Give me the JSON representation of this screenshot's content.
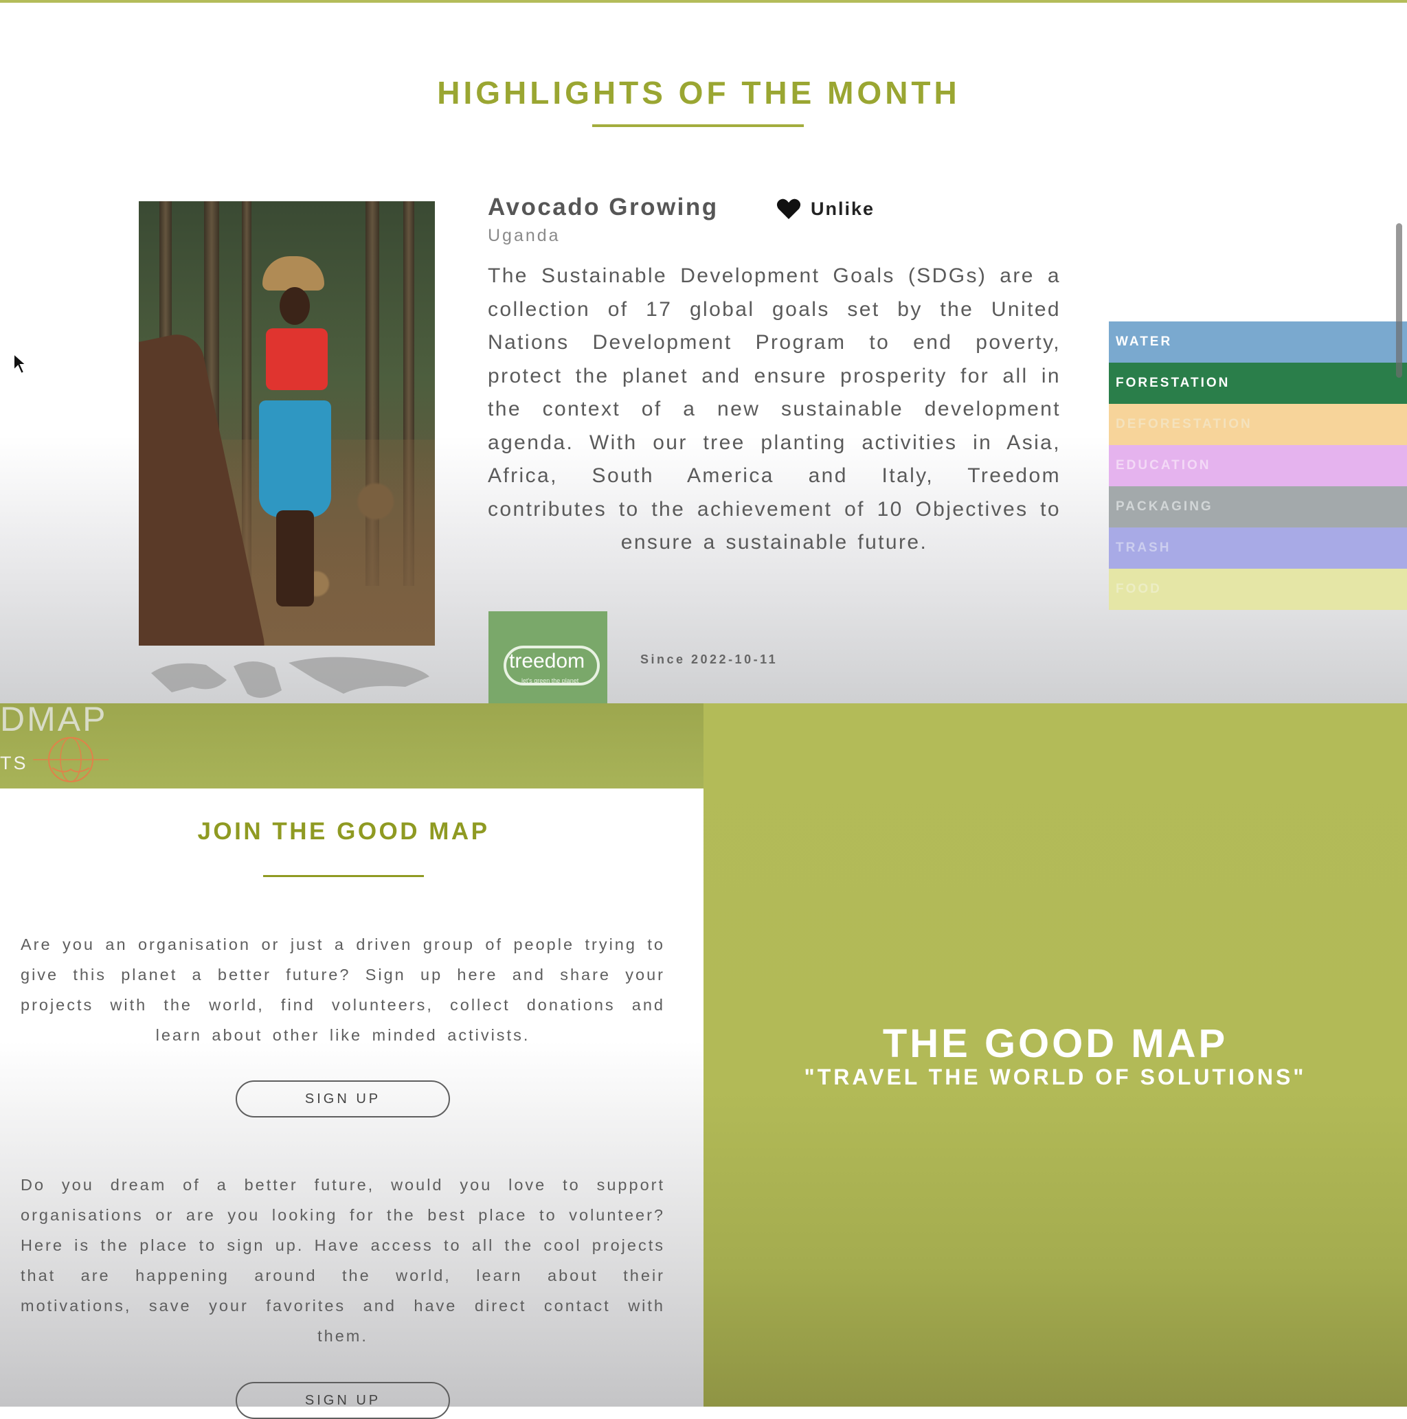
{
  "highlights": {
    "section_title": "HIGHLIGHTS OF THE MONTH",
    "project": {
      "title": "Avocado Growing",
      "location": "Uganda",
      "like_label": "Unlike",
      "description": "The Sustainable Development Goals (SDGs) are a collection of 17 global goals set by the United Nations Development Program to end poverty, protect the planet and ensure prosperity for all in the context of a new sustainable development agenda. With our tree planting activities in Asia, Africa, South America and Italy, Treedom contributes to the achievement of 10 Objectives to ensure a sustainable future.",
      "org_logo_text": "treedom",
      "org_logo_tagline": "let's green the planet",
      "since": "Since 2022-10-11"
    },
    "categories": [
      {
        "label": "WATER",
        "color": "#7aa9cf",
        "text_color": "#ffffff"
      },
      {
        "label": "FORESTATION",
        "color": "#2a7e4a",
        "text_color": "#ffffff"
      },
      {
        "label": "DEFORESTATION",
        "color": "#f7d49a",
        "text_color": "#f4e2bd"
      },
      {
        "label": "EDUCATION",
        "color": "#e5b3ee",
        "text_color": "#f3d9f6"
      },
      {
        "label": "PACKAGING",
        "color": "#a3a9ab",
        "text_color": "#d2d6d7"
      },
      {
        "label": "TRASH",
        "color": "#a8aae6",
        "text_color": "#ccceef"
      },
      {
        "label": "FOOD",
        "color": "#e5e6a6",
        "text_color": "#ecedc4"
      }
    ]
  },
  "join_page": {
    "header": {
      "brand_fragment": "DMAP",
      "nav_fragment": "TS"
    },
    "title": "JOIN THE GOOD MAP",
    "organisation_text": "Are you an organisation or just a driven group of people trying to give this planet a better future? Sign up here and share your projects with the world, find volunteers, collect donations and learn about other like minded activists.",
    "organisation_signup_label": "SIGN UP",
    "individual_text": "Do you dream of a better future, would you love to support organisations or are you looking for the best place to volunteer? Here is the place to sign up. Have access to all the cool projects that are happening around the world, learn about their motivations, save your favorites and have direct contact with them.",
    "individual_signup_label": "SIGN UP"
  },
  "hero": {
    "title": "THE GOOD MAP",
    "subtitle": "\"TRAVEL THE WORLD OF SOLUTIONS\""
  },
  "colors": {
    "accent_green": "#b3bb58",
    "title_green": "#9aa632"
  }
}
